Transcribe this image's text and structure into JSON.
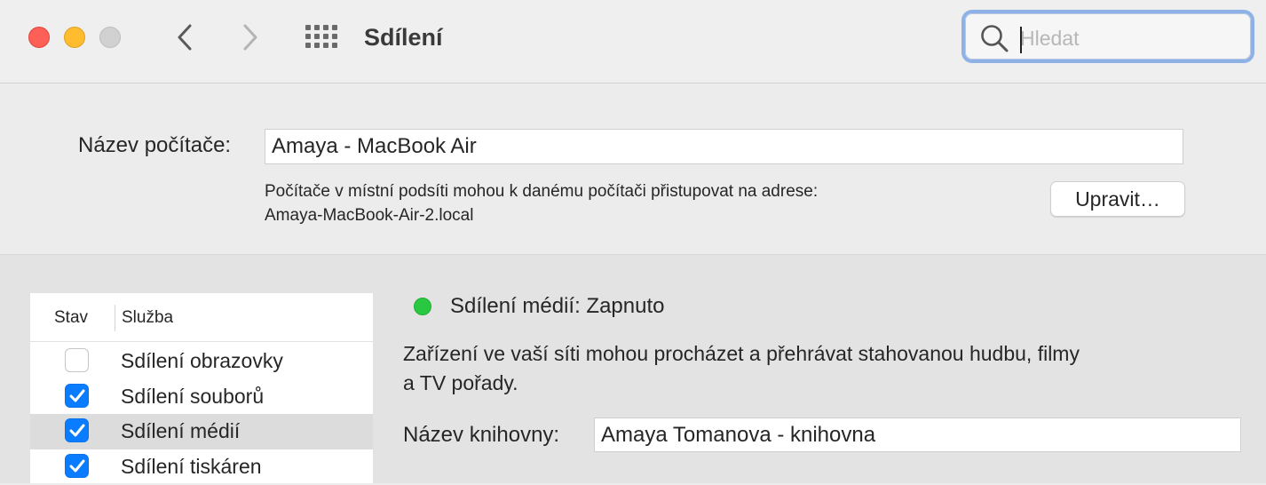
{
  "window": {
    "title": "Sdílení",
    "search_placeholder": "Hledat",
    "search_value": ""
  },
  "computer_name": {
    "label": "Název počítače:",
    "value": "Amaya - MacBook Air",
    "note_line1": "Počítače v místní podsíti mohou k danému počítači přistupovat na adrese:",
    "note_line2": "Amaya-MacBook-Air-2.local",
    "edit_button": "Upravit…"
  },
  "services": {
    "col_status": "Stav",
    "col_service": "Služba",
    "items": [
      {
        "label": "Sdílení obrazovky",
        "checked": false,
        "selected": false
      },
      {
        "label": "Sdílení souborů",
        "checked": true,
        "selected": false
      },
      {
        "label": "Sdílení médií",
        "checked": true,
        "selected": true
      },
      {
        "label": "Sdílení tiskáren",
        "checked": true,
        "selected": false
      }
    ]
  },
  "detail": {
    "status_text": "Sdílení médií: Zapnuto",
    "status_color": "#2ac840",
    "description_line1": "Zařízení ve vaší síti mohou procházet a přehrávat stahovanou hudbu, filmy",
    "description_line2": "a TV pořady.",
    "library_label": "Název knihovny:",
    "library_value": "Amaya Tomanova - knihovna"
  },
  "colors": {
    "accent": "#0a7cff",
    "close": "#fe5f57",
    "minimize": "#febc2e",
    "zoom_disabled": "#d1d1d1"
  }
}
